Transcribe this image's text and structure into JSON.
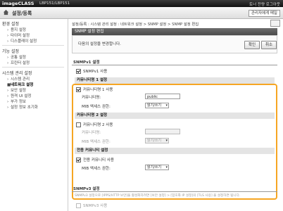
{
  "topbar": {
    "brand": "imageCLASS",
    "model": "LBP151/LBP151",
    "right": "토너 잔량  로그아웃"
  },
  "titlebar": {
    "title": "설정/등록",
    "admin": "관리자에게 메일"
  },
  "sidebar": {
    "groups": [
      {
        "label": "환경 설정",
        "items": [
          "용지 설정",
          "타이머 설정",
          "디스플레이 설정"
        ]
      },
      {
        "label": "기능 설정",
        "items": [
          "공통 설정",
          "프린터 설정"
        ]
      },
      {
        "label": "시스템 관리 설정",
        "items": [
          "시스템 관리",
          "네트워크 설정",
          "보안 설정",
          "원격 UI 설정",
          "부가 정보",
          "설정 정보 초기화"
        ]
      }
    ],
    "active": "네트워크 설정"
  },
  "breadcrumb": "설정/등록 : 시스템 관리 설정 : 네트워크 설정 > SNMP 설정 > SNMP 설정 편집",
  "edit": {
    "title": "SNMP 설정 편집",
    "message": "다음의 설정을 변경합니다.",
    "ok_label": "확인",
    "cancel_label": "취소"
  },
  "snmpv1": {
    "title": "SNMPv1 설정",
    "use_label": "SNMPv1 사용",
    "use_checked": true,
    "community1": {
      "title": "커뮤니티명 1 설정",
      "use_label": "커뮤니티명 1 사용",
      "use_checked": true,
      "name_label": "커뮤니티명:",
      "name_value": "public",
      "access_label": "MIB 액세스 권한:",
      "access_value": "읽기/쓰기"
    },
    "community2": {
      "title": "커뮤니티명 2 설정",
      "use_label": "커뮤니티명 2 사용",
      "use_checked": false,
      "name_label": "커뮤니티명:",
      "name_value": "",
      "access_label": "MIB 액세스 권한:",
      "access_value": "읽기/쓰기"
    },
    "dedicated": {
      "title": "전용 커뮤니티 설정",
      "use_label": "전용 커뮤니티 사용",
      "use_checked": true,
      "access_label": "MIB 액세스 권한:",
      "access_value": "읽기/쓰기"
    }
  },
  "snmpv3": {
    "title": "SNMPv3 설정",
    "note": "SNMPv3 설정으로 [IPPS/HTTP 보안]을 활성화하려면 [보안 설정] > [암호화 IP 설정]의 [TLS 사용] 을 설정하면 됩니다.",
    "use_label": "SNMPv3 사용"
  },
  "colors": {
    "accent": "#f6a623",
    "header": "#555555"
  }
}
